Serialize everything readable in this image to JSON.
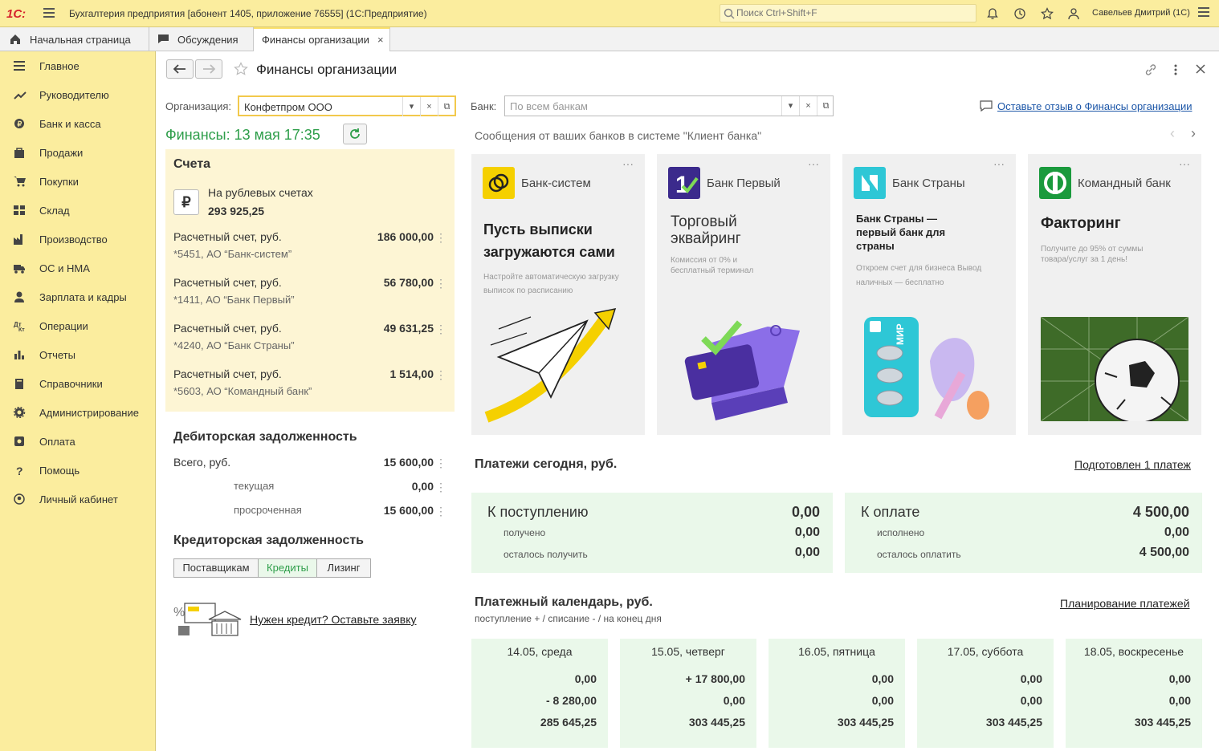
{
  "app": {
    "logo": "1С:",
    "title": "Бухгалтерия предприятия [абонент 1405, приложение 76555] (1С:Предприятие)",
    "search_placeholder": "Поиск Ctrl+Shift+F",
    "user": "Савельев Дмитрий (1С)"
  },
  "tabs": [
    {
      "label": "Начальная страница"
    },
    {
      "label": "Обсуждения"
    },
    {
      "label": "Финансы организации",
      "close": "×"
    }
  ],
  "sidebar": [
    {
      "label": "Главное",
      "icon": "menu-icon"
    },
    {
      "label": "Руководителю",
      "icon": "chart-line-icon"
    },
    {
      "label": "Банк и касса",
      "icon": "coin-icon"
    },
    {
      "label": "Продажи",
      "icon": "bag-icon"
    },
    {
      "label": "Покупки",
      "icon": "cart-icon"
    },
    {
      "label": "Склад",
      "icon": "warehouse-icon"
    },
    {
      "label": "Производство",
      "icon": "factory-icon"
    },
    {
      "label": "ОС и НМА",
      "icon": "truck-icon"
    },
    {
      "label": "Зарплата и кадры",
      "icon": "person-icon"
    },
    {
      "label": "Операции",
      "icon": "operations-icon"
    },
    {
      "label": "Отчеты",
      "icon": "bar-chart-icon"
    },
    {
      "label": "Справочники",
      "icon": "book-icon"
    },
    {
      "label": "Администрирование",
      "icon": "gear-icon"
    },
    {
      "label": "Оплата",
      "icon": "payment-icon"
    },
    {
      "label": "Помощь",
      "icon": "question-icon"
    },
    {
      "label": "Личный кабинет",
      "icon": "user-circle-icon"
    }
  ],
  "page": {
    "title": "Финансы организации",
    "org_label": "Организация:",
    "org_value": "Конфетпром ООО",
    "bank_label": "Банк:",
    "bank_placeholder": "По всем банкам",
    "feedback": "Оставьте отзыв о Финансы организации",
    "finance_date": "Финансы: 13 мая 17:35",
    "bank_messages": "Сообщения от ваших банков в системе \"Клиент банка\""
  },
  "accounts": {
    "title": "Счета",
    "ruble_label": "На рублевых счетах",
    "ruble_total": "293 925,25",
    "items": [
      {
        "name": "Расчетный счет, руб.",
        "sub": "*5451, АО “Банк-систем”",
        "amount": "186 000,00"
      },
      {
        "name": "Расчетный счет, руб.",
        "sub": "*1411, АО “Банк Первый”",
        "amount": "56 780,00"
      },
      {
        "name": "Расчетный счет, руб.",
        "sub": "*4240, АО “Банк Страны”",
        "amount": "49 631,25"
      },
      {
        "name": "Расчетный счет, руб.",
        "sub": "*5603, АО “Командный банк”",
        "amount": "1 514,00"
      }
    ]
  },
  "receivables": {
    "title": "Дебиторская задолженность",
    "rows": [
      {
        "label": "Всего, руб.",
        "value": "15 600,00"
      },
      {
        "label": "текущая",
        "value": "0,00"
      },
      {
        "label": "просроченная",
        "value": "15 600,00"
      }
    ]
  },
  "payables": {
    "title": "Кредиторская задолженность",
    "segments": [
      "Поставщикам",
      "Кредиты",
      "Лизинг"
    ],
    "active": "Кредиты"
  },
  "credit_link": "Нужен кредит? Оставьте заявку",
  "banners": [
    {
      "bank": "Банк-систем",
      "headline": "Пусть выписки загружаются сами",
      "sub": "Настройте автоматическую загрузку выписок по расписанию",
      "color": "#f5d000"
    },
    {
      "bank": "Банк Первый",
      "headline": "Торговый эквайринг",
      "sub": "Комиссия от 0% и бесплатный терминал",
      "color": "#3b2a8c"
    },
    {
      "bank": "Банк Страны",
      "headline": "Банк Страны — первый банк для страны",
      "sub": "Откроем счет для бизнеса Вывод наличных — бесплатно",
      "color": "#2ec7d6"
    },
    {
      "bank": "Командный банк",
      "headline": "Факторинг",
      "sub": "Получите до 95% от суммы товара/услуг за 1 день!",
      "color": "#1a9a3d"
    }
  ],
  "payments_today": {
    "title": "Платежи сегодня, руб.",
    "link": "Подготовлен 1 платеж",
    "in": {
      "label": "К поступлению",
      "total": "0,00",
      "r1l": "получено",
      "r1v": "0,00",
      "r2l": "осталось получить",
      "r2v": "0,00"
    },
    "out": {
      "label": "К оплате",
      "total": "4 500,00",
      "r1l": "исполнено",
      "r1v": "0,00",
      "r2l": "осталось оплатить",
      "r2v": "4 500,00"
    }
  },
  "calendar": {
    "title": "Платежный календарь, руб.",
    "sub": "поступление + / списание - / на конец дня",
    "link": "Планирование платежей",
    "days": [
      {
        "day": "14.05, среда",
        "in": "0,00",
        "out": "- 8 280,00",
        "end": "285 645,25"
      },
      {
        "day": "15.05, четверг",
        "in": "+ 17 800,00",
        "out": "0,00",
        "end": "303 445,25"
      },
      {
        "day": "16.05, пятница",
        "in": "0,00",
        "out": "0,00",
        "end": "303 445,25"
      },
      {
        "day": "17.05, суббота",
        "in": "0,00",
        "out": "0,00",
        "end": "303 445,25"
      },
      {
        "day": "18.05, воскресенье",
        "in": "0,00",
        "out": "0,00",
        "end": "303 445,25"
      }
    ]
  }
}
